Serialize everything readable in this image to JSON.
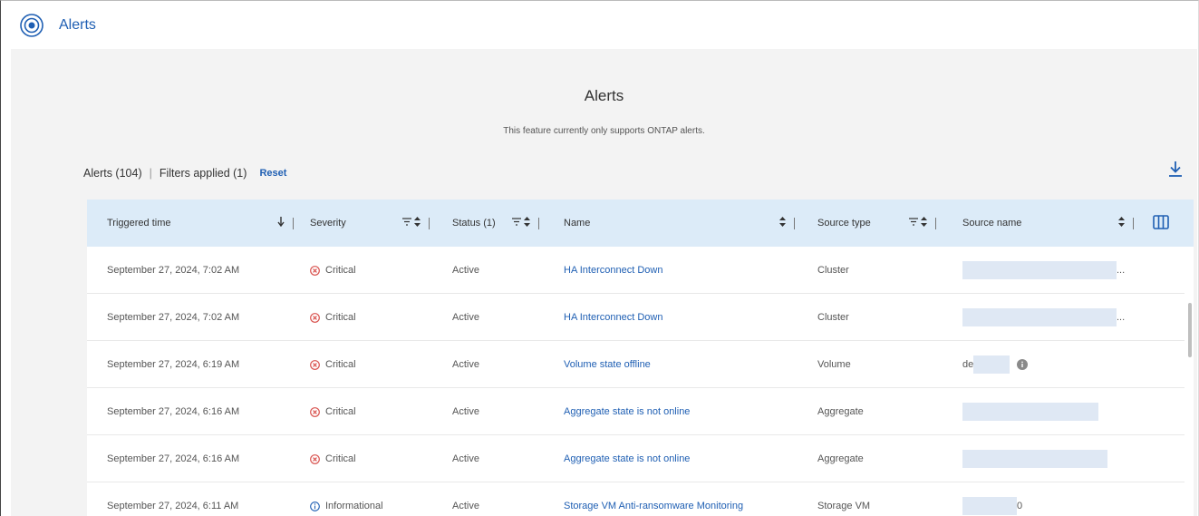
{
  "app": {
    "title": "Alerts",
    "icon": "alerts-target-icon"
  },
  "page": {
    "title": "Alerts",
    "subtitle": "This feature currently only supports ONTAP alerts."
  },
  "summary": {
    "alerts_count": "Alerts (104)",
    "filters": "Filters applied (1)",
    "reset": "Reset"
  },
  "columns": {
    "triggered_time": "Triggered time",
    "severity": "Severity",
    "status": "Status (1)",
    "name": "Name",
    "source_type": "Source type",
    "source_name": "Source name"
  },
  "rows": [
    {
      "time": "September 27, 2024, 7:02 AM",
      "severity": "Critical",
      "status": "Active",
      "name": "HA Interconnect Down",
      "source_type": "Cluster",
      "source_name": "...",
      "source_prefix": ""
    },
    {
      "time": "September 27, 2024, 7:02 AM",
      "severity": "Critical",
      "status": "Active",
      "name": "HA Interconnect Down",
      "source_type": "Cluster",
      "source_name": "...",
      "source_prefix": ""
    },
    {
      "time": "September 27, 2024, 6:19 AM",
      "severity": "Critical",
      "status": "Active",
      "name": "Volume state offline",
      "source_type": "Volume",
      "source_name": "",
      "source_prefix": "de"
    },
    {
      "time": "September 27, 2024, 6:16 AM",
      "severity": "Critical",
      "status": "Active",
      "name": "Aggregate state is not online",
      "source_type": "Aggregate",
      "source_name": "",
      "source_prefix": ""
    },
    {
      "time": "September 27, 2024, 6:16 AM",
      "severity": "Critical",
      "status": "Active",
      "name": "Aggregate state is not online",
      "source_type": "Aggregate",
      "source_name": "",
      "source_prefix": ""
    },
    {
      "time": "September 27, 2024, 6:11 AM",
      "severity": "Informational",
      "status": "Active",
      "name": "Storage VM Anti-ransomware Monitoring",
      "source_type": "Storage VM",
      "source_name": "0",
      "source_prefix": ""
    }
  ],
  "colors": {
    "link": "#1f5fb3",
    "critical": "#d9534f",
    "info": "#1f5fb3",
    "header_bg": "#dcebf8",
    "content_bg": "#f3f3f3"
  }
}
